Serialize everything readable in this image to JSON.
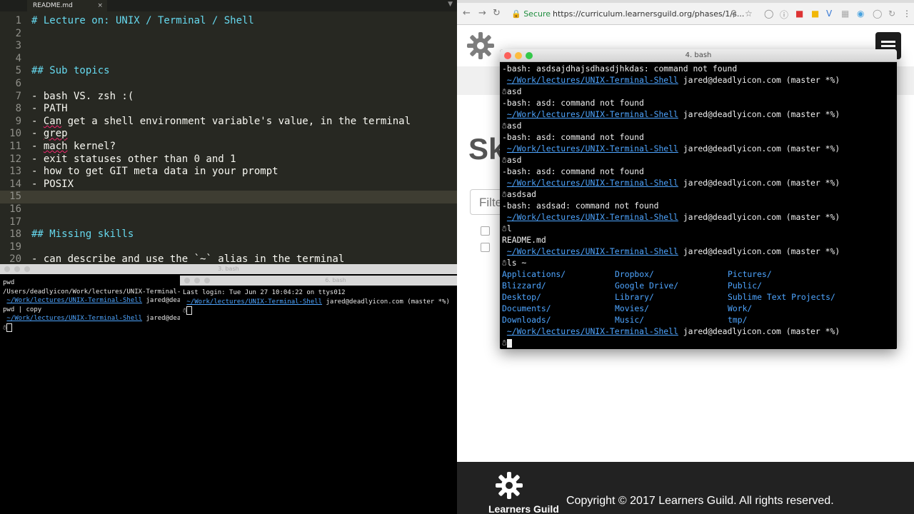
{
  "editor": {
    "tab_label": "README.md",
    "tab_close": "×",
    "dropdown": "▼",
    "current_line": 15,
    "lines": [
      {
        "n": "1",
        "text": "# Lecture on: UNIX / Terminal / Shell",
        "kind": "hdr"
      },
      {
        "n": "2",
        "text": ""
      },
      {
        "n": "3",
        "text": ""
      },
      {
        "n": "4",
        "text": ""
      },
      {
        "n": "5",
        "text": "## Sub topics",
        "kind": "hdr"
      },
      {
        "n": "6",
        "text": ""
      },
      {
        "n": "7",
        "text": "- bash VS. zsh :("
      },
      {
        "n": "8",
        "text": "- PATH"
      },
      {
        "n": "9",
        "text": "- Can get a shell environment variable's value, in the terminal"
      },
      {
        "n": "10",
        "text": "- grep"
      },
      {
        "n": "11",
        "text": "- mach kernel?"
      },
      {
        "n": "12",
        "text": "- exit statuses other than 0 and 1"
      },
      {
        "n": "13",
        "text": "- how to get GIT meta data in your prompt"
      },
      {
        "n": "14",
        "text": "- POSIX"
      },
      {
        "n": "15",
        "text": ""
      },
      {
        "n": "16",
        "text": ""
      },
      {
        "n": "17",
        "text": ""
      },
      {
        "n": "18",
        "text": "## Missing skills",
        "kind": "hdr"
      },
      {
        "n": "19",
        "text": ""
      },
      {
        "n": "20",
        "text": "- can describe and use the `~` alias in the terminal"
      }
    ]
  },
  "terminal3": {
    "title": "3. bash",
    "lines": [
      {
        "text": "pwd"
      },
      {
        "text": "/Users/deadlyicon/Work/lectures/UNIX-Terminal-Shell"
      },
      {
        "path": "~/Work/lectures/UNIX-Terminal-Shell",
        "rest": " jared@dea"
      },
      {
        "text": "pwd | copy"
      },
      {
        "path": "~/Work/lectures/UNIX-Terminal-Shell",
        "rest": " jared@dea"
      }
    ]
  },
  "terminal6": {
    "title": "6. bash",
    "login": "Last login: Tue Jun 27 10:04:22 on ttys012",
    "path": "~/Work/lectures/UNIX-Terminal-Shell",
    "rest": " jared@deadlyicon.com (master *%)"
  },
  "browser": {
    "secure_label": "Secure",
    "url": "https://curriculum.learnersguild.org/phases/1/s...",
    "heading_fragment": "Sk",
    "filter_placeholder": "Filte",
    "footer_brand": "Learners Guild",
    "copyright": "Copyright © 2017 Learners Guild. All rights reserved."
  },
  "terminal4": {
    "title": "4. bash",
    "prompt_path": "~/Work/lectures/UNIX-Terminal-Shell",
    "prompt_rest": " jared@deadlyicon.com (master *%)",
    "lines": [
      {
        "type": "out",
        "text": "-bash: asdsajdhajsdhasdjhkdas: command not found"
      },
      {
        "type": "prompt"
      },
      {
        "type": "cmd",
        "text": "asd"
      },
      {
        "type": "out",
        "text": "-bash: asd: command not found"
      },
      {
        "type": "prompt"
      },
      {
        "type": "cmd",
        "text": "asd"
      },
      {
        "type": "out",
        "text": "-bash: asd: command not found"
      },
      {
        "type": "prompt"
      },
      {
        "type": "cmd",
        "text": "asd"
      },
      {
        "type": "out",
        "text": "-bash: asd: command not found"
      },
      {
        "type": "prompt"
      },
      {
        "type": "cmd",
        "text": "asdsad"
      },
      {
        "type": "out",
        "text": "-bash: asdsad: command not found"
      },
      {
        "type": "prompt"
      },
      {
        "type": "cmd",
        "text": "l"
      },
      {
        "type": "out",
        "text": "README.md"
      },
      {
        "type": "prompt"
      },
      {
        "type": "cmd",
        "text": "ls ~"
      }
    ],
    "ls_columns": [
      [
        "Applications/",
        "Blizzard/",
        "Desktop/",
        "Documents/",
        "Downloads/"
      ],
      [
        "Dropbox/",
        "Google Drive/",
        "Library/",
        "Movies/",
        "Music/"
      ],
      [
        "Pictures/",
        "Public/",
        "Sublime Text Projects/",
        "Work/",
        "tmp/"
      ]
    ]
  }
}
